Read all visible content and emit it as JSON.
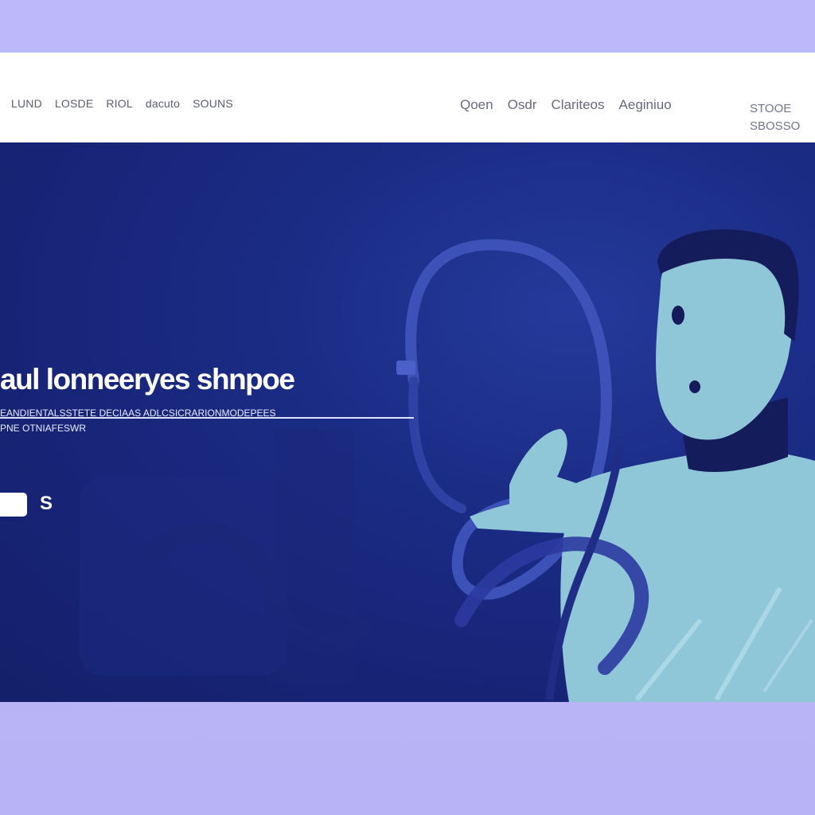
{
  "nav": {
    "left_links": [
      "LUND",
      "LOSDE",
      "RIOL",
      "dacuto",
      "SOUNS"
    ],
    "right_links": [
      "Qoen",
      "Osdr",
      "Clariteos",
      "Aeginiuo"
    ],
    "account_line1": "STOOE",
    "account_line2": "SBOSSO"
  },
  "hero": {
    "title": "aul lonneeryes shnpoe",
    "subtitle": "EANDIENTALSSTETE DECIAAS ADLCSICRARIONMODEPEES",
    "subtitle2": "PNE OTNIAFESWR",
    "cta_label": "",
    "cta_secondary_label": "S"
  },
  "colors": {
    "page_bg": "#b9b4f6",
    "nav_bg": "#ffffff",
    "hero_bg": "#1b2c86",
    "figure_skin": "#8fc6d8",
    "figure_hair": "#141c5c",
    "hose": "#3d52b8"
  }
}
